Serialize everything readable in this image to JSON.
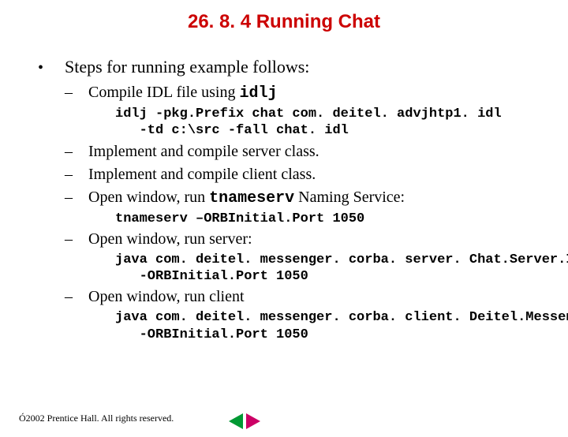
{
  "title": "26. 8. 4   Running Chat",
  "main_bullet": "Steps for running example follows:",
  "sub1_prefix": "Compile IDL file using ",
  "sub1_code": "idlj",
  "code1_line1": "idlj -pkg.Prefix chat com. deitel. advjhtp1. idl",
  "code1_line2": "   -td c:\\src -fall chat. idl",
  "sub2": "Implement and compile server class.",
  "sub3": "Implement and compile client class.",
  "sub4_prefix": "Open window, run ",
  "sub4_code": "tnameserv",
  "sub4_suffix": " Naming Service:",
  "code2": "tnameserv –ORBInitial.Port 1050",
  "sub5": "Open window, run server:",
  "code3_line1": "java com. deitel. messenger. corba. server. Chat.Server.Impl",
  "code3_line2": "   -ORBInitial.Port 1050",
  "sub6": "Open window, run client",
  "code4_line1": "java com. deitel. messenger. corba. client. Deitel.Messenger",
  "code4_line2": "   -ORBInitial.Port 1050",
  "copyright_symbol": "Ó",
  "copyright_text": " 2002 Prentice Hall. All rights reserved."
}
